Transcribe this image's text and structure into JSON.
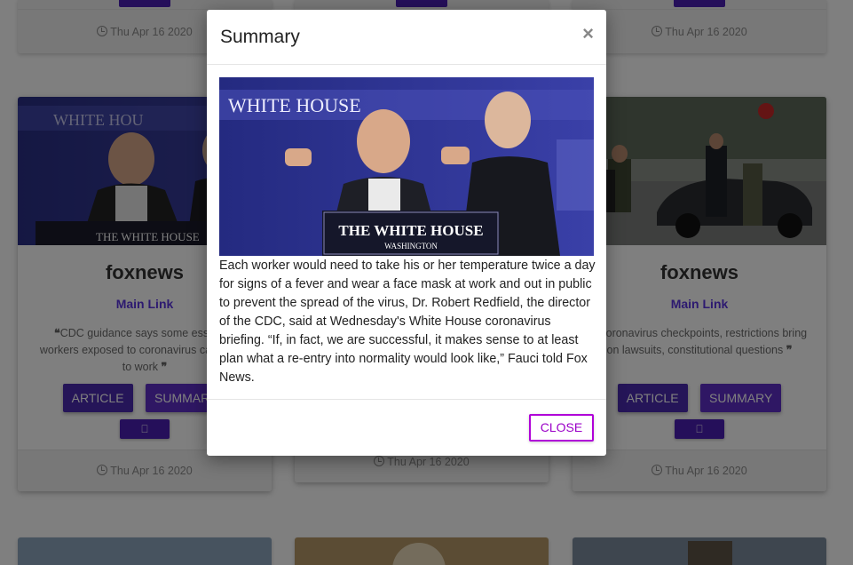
{
  "top_cards": [
    {
      "date": "Thu Apr 16 2020"
    },
    {
      "date": ""
    },
    {
      "date": "Thu Apr 16 2020"
    }
  ],
  "cards": [
    {
      "source": "foxnews",
      "link_label": "Main Link",
      "quote": "CDC guidance says some essential workers exposed to coronavirus can return to work",
      "article_label": "ARTICLE",
      "summary_label": "SUMMARY",
      "date": "Thu Apr 16 2020"
    },
    {
      "source": "",
      "link_label": "",
      "quote": "",
      "article_label": "",
      "summary_label": "",
      "date": "Thu Apr 16 2020"
    },
    {
      "source": "foxnews",
      "link_label": "Main Link",
      "quote": "Coronavirus checkpoints, restrictions bring on lawsuits, constitutional questions",
      "article_label": "ARTICLE",
      "summary_label": "SUMMARY",
      "date": "Thu Apr 16 2020"
    }
  ],
  "modal": {
    "title": "Summary",
    "close_symbol": "×",
    "image_caption": "THE WHITE HOUSE",
    "image_subcaption": "WASHINGTON",
    "image_backdrop_text": "WHITE HOUSE",
    "text": "Each worker would need to take his or her temperature twice a day for signs of a fever and wear a face mask at work and out in public to prevent the spread of the virus, Dr. Robert Redfield, the director of the CDC, said at Wednesday's White House coronavirus briefing. “If, in fact, we are successful, it makes sense to at least plan what a re-entry into normality would look like,” Fauci told Fox News.",
    "close_label": "CLOSE"
  },
  "colors": {
    "accent": "#5a2ab8",
    "close_border": "#b000d8",
    "link": "#5a35e0"
  },
  "icons": [
    "clock-icon",
    "bookmark-icon",
    "quote-open-icon",
    "quote-close-icon",
    "close-icon"
  ]
}
